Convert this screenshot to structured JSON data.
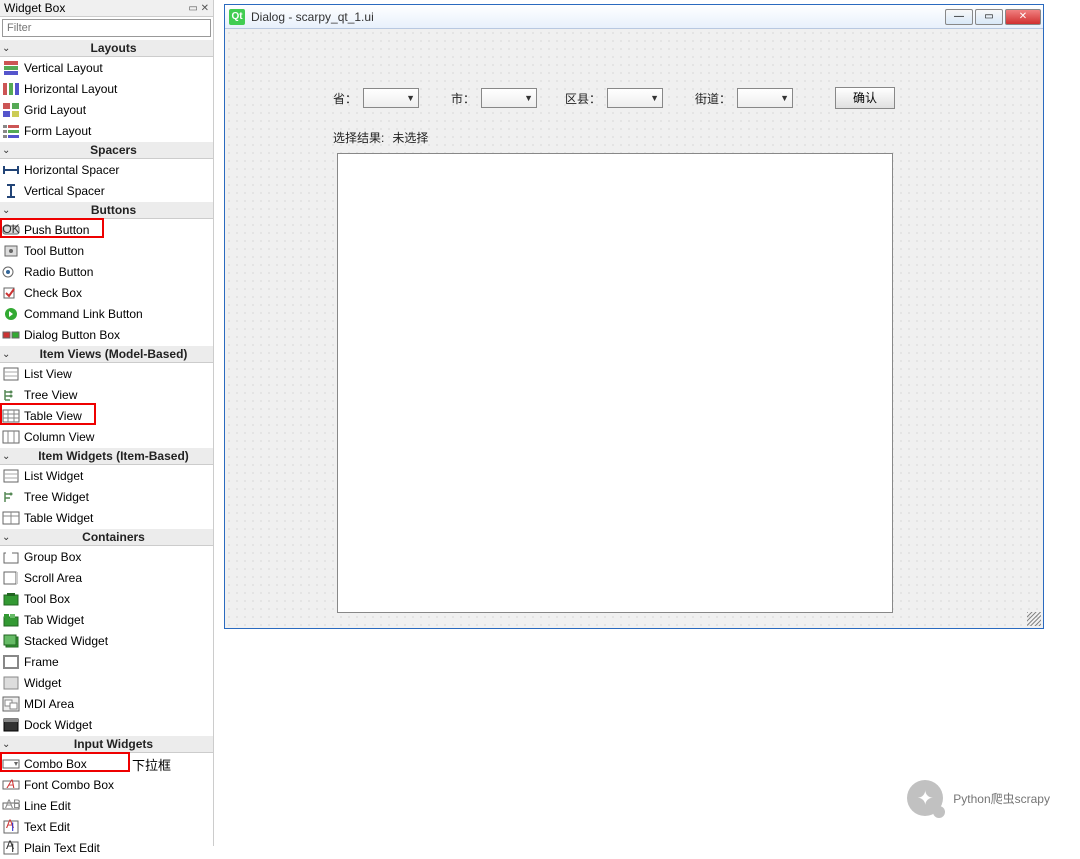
{
  "panel": {
    "title": "Widget Box",
    "filter_placeholder": "Filter"
  },
  "categories": [
    {
      "key": "layouts",
      "label": "Layouts",
      "items": [
        {
          "label": "Vertical Layout",
          "icon": "vlayout-icon"
        },
        {
          "label": "Horizontal Layout",
          "icon": "hlayout-icon"
        },
        {
          "label": "Grid Layout",
          "icon": "grid-icon"
        },
        {
          "label": "Form Layout",
          "icon": "form-icon"
        }
      ]
    },
    {
      "key": "spacers",
      "label": "Spacers",
      "items": [
        {
          "label": "Horizontal Spacer",
          "icon": "hspacer-icon"
        },
        {
          "label": "Vertical Spacer",
          "icon": "vspacer-icon"
        }
      ]
    },
    {
      "key": "buttons",
      "label": "Buttons",
      "items": [
        {
          "label": "Push Button",
          "icon": "pushbtn-icon",
          "highlight": "hl-pushbtn"
        },
        {
          "label": "Tool Button",
          "icon": "toolbtn-icon"
        },
        {
          "label": "Radio Button",
          "icon": "radio-icon"
        },
        {
          "label": "Check Box",
          "icon": "check-icon"
        },
        {
          "label": "Command Link Button",
          "icon": "cmdlink-icon"
        },
        {
          "label": "Dialog Button Box",
          "icon": "dlgbtnbox-icon"
        }
      ]
    },
    {
      "key": "itemviews",
      "label": "Item Views (Model-Based)",
      "items": [
        {
          "label": "List View",
          "icon": "listview-icon"
        },
        {
          "label": "Tree View",
          "icon": "treeview-icon"
        },
        {
          "label": "Table View",
          "icon": "tableview-icon",
          "highlight": "hl-tableview"
        },
        {
          "label": "Column View",
          "icon": "colview-icon"
        }
      ]
    },
    {
      "key": "itemwidgets",
      "label": "Item Widgets (Item-Based)",
      "items": [
        {
          "label": "List Widget",
          "icon": "listwidget-icon"
        },
        {
          "label": "Tree Widget",
          "icon": "treewidget-icon"
        },
        {
          "label": "Table Widget",
          "icon": "tablewidget-icon"
        }
      ]
    },
    {
      "key": "containers",
      "label": "Containers",
      "items": [
        {
          "label": "Group Box",
          "icon": "groupbox-icon"
        },
        {
          "label": "Scroll Area",
          "icon": "scrollarea-icon"
        },
        {
          "label": "Tool Box",
          "icon": "toolbox-icon"
        },
        {
          "label": "Tab Widget",
          "icon": "tabwidget-icon"
        },
        {
          "label": "Stacked Widget",
          "icon": "stacked-icon"
        },
        {
          "label": "Frame",
          "icon": "frame-icon"
        },
        {
          "label": "Widget",
          "icon": "widget-icon"
        },
        {
          "label": "MDI Area",
          "icon": "mdi-icon"
        },
        {
          "label": "Dock Widget",
          "icon": "dockwidget-icon"
        }
      ]
    },
    {
      "key": "inputs",
      "label": "Input Widgets",
      "items": [
        {
          "label": "Combo Box",
          "icon": "combo-icon",
          "highlight": "hl-combo",
          "note": "下拉框"
        },
        {
          "label": "Font Combo Box",
          "icon": "fontcombo-icon"
        },
        {
          "label": "Line Edit",
          "icon": "lineedit-icon"
        },
        {
          "label": "Text Edit",
          "icon": "textedit-icon"
        },
        {
          "label": "Plain Text Edit",
          "icon": "plaintext-icon"
        }
      ]
    }
  ],
  "dialog": {
    "title": "Dialog - scarpy_qt_1.ui",
    "labels": {
      "province": "省：",
      "city": "市：",
      "county": "区县：",
      "street": "街道："
    },
    "ok_button": "确认",
    "result_label": "选择结果:",
    "result_value": "未选择"
  },
  "watermark": "Python爬虫scrapy"
}
